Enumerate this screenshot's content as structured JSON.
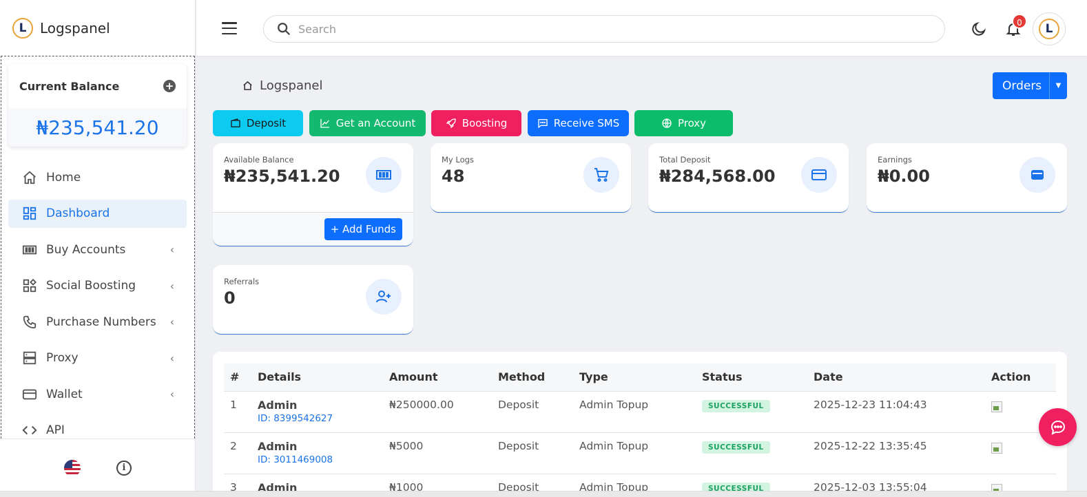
{
  "app": {
    "name": "Logspanel",
    "logo_letter": "L"
  },
  "balance_card": {
    "title": "Current Balance",
    "amount": "₦235,541.20"
  },
  "nav": [
    {
      "label": "Home",
      "icon": "home-icon",
      "active": false,
      "has_submenu": false
    },
    {
      "label": "Dashboard",
      "icon": "dashboard-icon",
      "active": true,
      "has_submenu": false
    },
    {
      "label": "Buy Accounts",
      "icon": "money-icon",
      "active": false,
      "has_submenu": true
    },
    {
      "label": "Social Boosting",
      "icon": "widgets-icon",
      "active": false,
      "has_submenu": true
    },
    {
      "label": "Purchase Numbers",
      "icon": "phone-icon",
      "active": false,
      "has_submenu": true
    },
    {
      "label": "Proxy",
      "icon": "server-icon",
      "active": false,
      "has_submenu": true
    },
    {
      "label": "Wallet",
      "icon": "wallet-icon",
      "active": false,
      "has_submenu": true
    },
    {
      "label": "API",
      "icon": "code-icon",
      "active": false,
      "has_submenu": false
    }
  ],
  "topbar": {
    "search_placeholder": "Search",
    "notification_count": "0"
  },
  "breadcrumb": {
    "label": "Logspanel"
  },
  "orders_button": {
    "label": "Orders"
  },
  "quick_actions": [
    {
      "label": "Deposit",
      "color": "#0dcaf0"
    },
    {
      "label": "Get an Account",
      "color": "#14b86f"
    },
    {
      "label": "Boosting",
      "color": "#f01f60"
    },
    {
      "label": "Receive SMS",
      "color": "#0d6efd"
    },
    {
      "label": "Proxy",
      "color": "#0cbc6a"
    }
  ],
  "stats": {
    "available_balance": {
      "label": "Available Balance",
      "value": "₦235,541.20",
      "action": "+ Add Funds"
    },
    "my_logs": {
      "label": "My Logs",
      "value": "48"
    },
    "total_deposit": {
      "label": "Total Deposit",
      "value": "₦284,568.00"
    },
    "earnings": {
      "label": "Earnings",
      "value": "₦0.00"
    },
    "referrals": {
      "label": "Referrals",
      "value": "0"
    }
  },
  "table": {
    "headers": [
      "#",
      "Details",
      "Amount",
      "Method",
      "Type",
      "Status",
      "Date",
      "Action"
    ],
    "rows": [
      {
        "n": "1",
        "name": "Admin",
        "id": "ID: 8399542627",
        "amount": "₦250000.00",
        "method": "Deposit",
        "type": "Admin Topup",
        "status": "SUCCESSFUL",
        "date": "2025-12-23 11:04:43"
      },
      {
        "n": "2",
        "name": "Admin",
        "id": "ID: 3011469008",
        "amount": "₦5000",
        "method": "Deposit",
        "type": "Admin Topup",
        "status": "SUCCESSFUL",
        "date": "2025-12-22 13:35:45"
      },
      {
        "n": "3",
        "name": "Admin",
        "id": "",
        "amount": "₦1000",
        "method": "Deposit",
        "type": "Admin Topup",
        "status": "SUCCESSFUL",
        "date": "2025-12-03 13:55:04"
      }
    ]
  },
  "colors": {
    "primary": "#0d6efd",
    "accent_blue": "#1a73e8",
    "success": "#1aa260"
  }
}
